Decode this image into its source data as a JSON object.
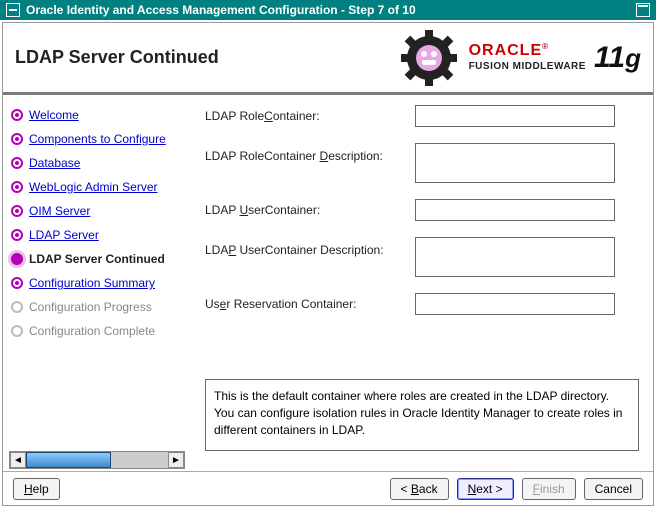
{
  "window": {
    "title": "Oracle Identity and Access Management Configuration - Step 7 of 10"
  },
  "header": {
    "page_title": "LDAP Server Continued",
    "brand_word": "ORACLE",
    "brand_sub": "FUSION MIDDLEWARE",
    "version_num": "11",
    "version_suffix": "g"
  },
  "sidebar": {
    "items": [
      {
        "label": "Welcome",
        "state": "done"
      },
      {
        "label": "Components to Configure",
        "state": "done"
      },
      {
        "label": "Database",
        "state": "done"
      },
      {
        "label": "WebLogic Admin Server",
        "state": "done"
      },
      {
        "label": "OIM Server",
        "state": "done"
      },
      {
        "label": "LDAP Server",
        "state": "done"
      },
      {
        "label": "LDAP Server Continued",
        "state": "current"
      },
      {
        "label": "Configuration Summary",
        "state": "next"
      },
      {
        "label": "Configuration Progress",
        "state": "future"
      },
      {
        "label": "Configuration Complete",
        "state": "future"
      }
    ]
  },
  "form": {
    "role_container": {
      "pre": "LDAP Role",
      "mn": "C",
      "post": "ontainer:",
      "value": ""
    },
    "role_desc": {
      "pre": "LDAP RoleContainer ",
      "mn": "D",
      "post": "escription:",
      "value": ""
    },
    "user_container": {
      "pre": "LDAP ",
      "mn": "U",
      "post": "serContainer:",
      "value": ""
    },
    "user_desc": {
      "pre": "LDA",
      "mn": "P",
      "post": " UserContainer Description:",
      "value": ""
    },
    "reservation": {
      "pre": "Us",
      "mn": "e",
      "post": "r Reservation Container:",
      "value": ""
    }
  },
  "help_text": "This is the default container where roles are created in the LDAP directory. You can configure isolation rules in Oracle Identity Manager to create roles in different containers in LDAP.",
  "footer": {
    "help": "elp",
    "help_mn": "H",
    "back_mn": "B",
    "back": "ack",
    "next_mn": "N",
    "next": "ext",
    "finish_mn": "F",
    "finish": "inish",
    "cancel": "Cancel",
    "lt": "< ",
    "gt": " >"
  }
}
